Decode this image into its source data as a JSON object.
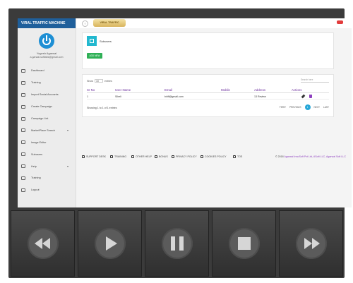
{
  "sidebar": {
    "brand": "VIRAL TRAFFIC MACHINE",
    "user_name": "Yogesh Agarwal",
    "user_email": "a.garwal.softlabs@gmail.com",
    "items": [
      {
        "label": "Dashboard",
        "icon": "dashboard-icon"
      },
      {
        "label": "Training",
        "icon": "monitor-icon"
      },
      {
        "label": "Import Social Accounts",
        "icon": "import-icon"
      },
      {
        "label": "Create Campaign",
        "icon": "document-icon"
      },
      {
        "label": "Campaign List",
        "icon": "list-icon"
      },
      {
        "label": "MarketPlace Search",
        "icon": "market-icon",
        "caret": "▾"
      },
      {
        "label": "Image Editor",
        "icon": "image-icon"
      },
      {
        "label": "Subusers",
        "icon": "key-icon"
      },
      {
        "label": "Help",
        "icon": "help-icon",
        "caret": "▾"
      },
      {
        "label": "Training",
        "icon": "monitor-icon"
      },
      {
        "label": "Logout",
        "icon": "logout-icon"
      }
    ]
  },
  "topbar": {
    "menu_glyph": "‹",
    "logo_text": "VIRAL TRAFFIC"
  },
  "card": {
    "title": "Subusers",
    "add_button": "ADD NEW"
  },
  "table": {
    "show_label": "Show",
    "show_value": "10",
    "entries_label": "entries",
    "search_placeholder": "Search here",
    "headers": [
      "Sr No",
      "User Name",
      "Email",
      "Mobile",
      "Address",
      "Actions"
    ],
    "rows": [
      {
        "sr": "1",
        "user": "Siheli",
        "email": "biriff@gmail.com",
        "mobile": "",
        "address": "13 Review"
      }
    ],
    "info": "Showing 1 to 1 of 1 entries",
    "pager": {
      "first": "FIRST",
      "previous": "PREVIOUS",
      "current": "1",
      "next": "NEXT",
      "last": "LAST"
    }
  },
  "footer": {
    "links": [
      "SUPPORT DESK",
      "TRAINING",
      "OTHER HELP",
      "BONUS",
      "PRIVACY POLICY",
      "COOKIES POLICY",
      "TOS"
    ],
    "copyright_prefix": "© 2018",
    "copyright_brand": "Agarwal InnoSoft Pvt Ltd, ASoft LLC, Agarwal Soft LLC"
  },
  "controls": [
    "rewind",
    "play",
    "pause",
    "stop",
    "fast-forward"
  ],
  "colors": {
    "brand_blue": "#1f5f9b",
    "accent_purple": "#6a2b9c",
    "add_green": "#2fb056",
    "pager_blue": "#27a7d8"
  }
}
